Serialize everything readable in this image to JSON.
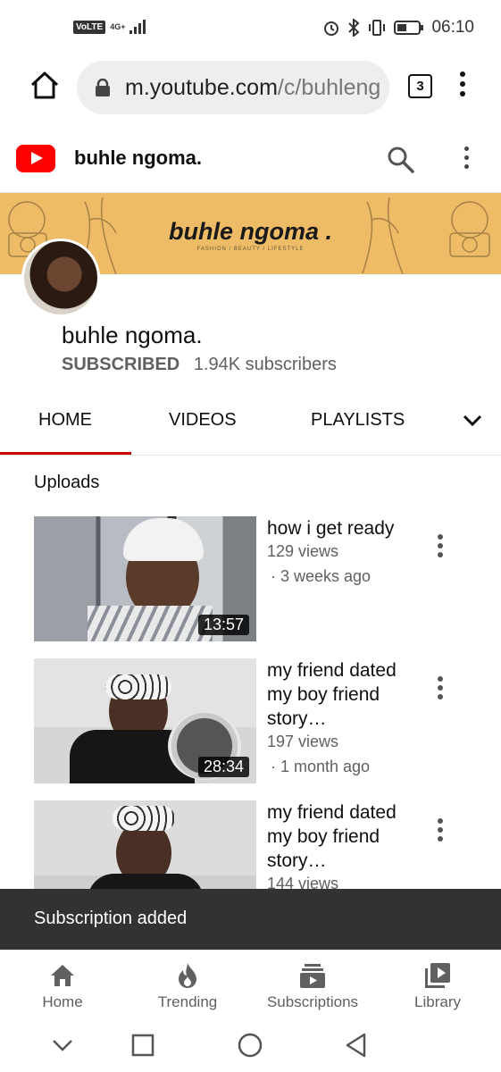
{
  "status_bar": {
    "volte": "VoLTE",
    "network": "4G+",
    "time": "06:10"
  },
  "browser": {
    "url_host": "m.youtube.com",
    "url_path": "/c/buhleng",
    "tab_count": "3"
  },
  "header": {
    "title": "buhle ngoma."
  },
  "banner": {
    "title": "buhle ngoma .",
    "subtitle": "FASHION / BEAUTY / LIFESTYLE"
  },
  "channel": {
    "name": "buhle ngoma.",
    "subscription_status": "SUBSCRIBED",
    "subscribers": "1.94K subscribers"
  },
  "tabs": [
    {
      "label": "HOME",
      "active": true
    },
    {
      "label": "VIDEOS",
      "active": false
    },
    {
      "label": "PLAYLISTS",
      "active": false
    }
  ],
  "section": {
    "title": "Uploads"
  },
  "videos": [
    {
      "title": "how i get ready",
      "views": "129 views",
      "age": "· 3 weeks ago",
      "duration": "13:57"
    },
    {
      "title": "my friend dated my boy friend story…",
      "views": "197 views",
      "age": "· 1 month ago",
      "duration": "28:34"
    },
    {
      "title": "my friend dated my boy friend story…",
      "views": "144 views",
      "age": "",
      "duration": ""
    }
  ],
  "snackbar": {
    "message": "Subscription added"
  },
  "bottom_nav": [
    {
      "label": "Home",
      "icon": "home-icon"
    },
    {
      "label": "Trending",
      "icon": "trending-icon"
    },
    {
      "label": "Subscriptions",
      "icon": "subscriptions-icon"
    },
    {
      "label": "Library",
      "icon": "library-icon"
    }
  ],
  "colors": {
    "brand_red": "#ff0000",
    "active_tab_underline": "#cc0000",
    "banner_bg": "#eebb66",
    "snackbar_bg": "#323232"
  }
}
